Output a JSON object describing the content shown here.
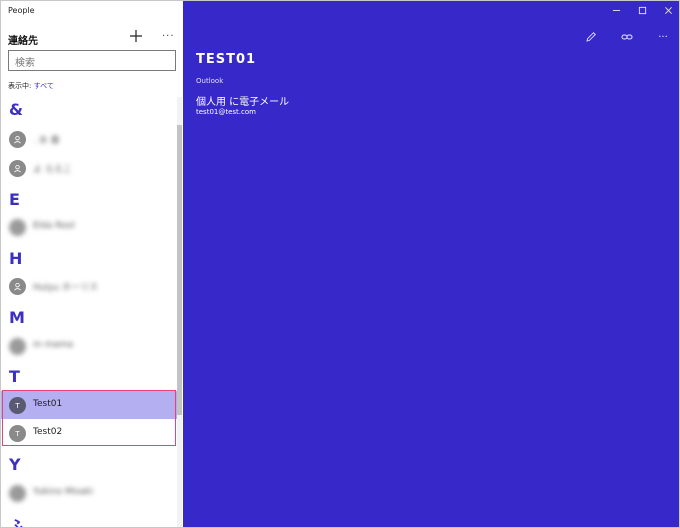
{
  "app": {
    "title": "People"
  },
  "sidebar": {
    "title": "連絡先",
    "search_placeholder": "検索",
    "filter_label": "表示中: ",
    "filter_value": "すべて"
  },
  "groups": [
    {
      "letter": "&",
      "contacts": [
        ". 水 春",
        "よ らえこ"
      ]
    },
    {
      "letter": "E",
      "contacts": [
        "Elda Rool"
      ]
    },
    {
      "letter": "H",
      "contacts": [
        "Hulyu ホーリス"
      ]
    },
    {
      "letter": "M",
      "contacts": [
        "m mama"
      ]
    },
    {
      "letter": "T",
      "contacts": [
        "Test01",
        "Test02"
      ]
    },
    {
      "letter": "Y",
      "contacts": [
        "Yukino Misaki"
      ]
    },
    {
      "letter": "ふ",
      "contacts": []
    }
  ],
  "avatars": {
    "test01": "T",
    "test02": "T"
  },
  "detail": {
    "name": "TEST01",
    "source": "Outlook",
    "email_label": "個人用 に電子メール",
    "email_value": "test01@test.com"
  },
  "icons": {
    "add": "plus-icon",
    "more": "more-icon",
    "edit": "pencil-icon",
    "link": "link-icon",
    "minimize": "minimize-icon",
    "maximize": "maximize-icon",
    "close": "close-icon"
  },
  "colors": {
    "accent": "#3728c9",
    "selected": "#b3aff0",
    "highlight_border": "#e0457c",
    "group_letter": "#3b30c0"
  }
}
